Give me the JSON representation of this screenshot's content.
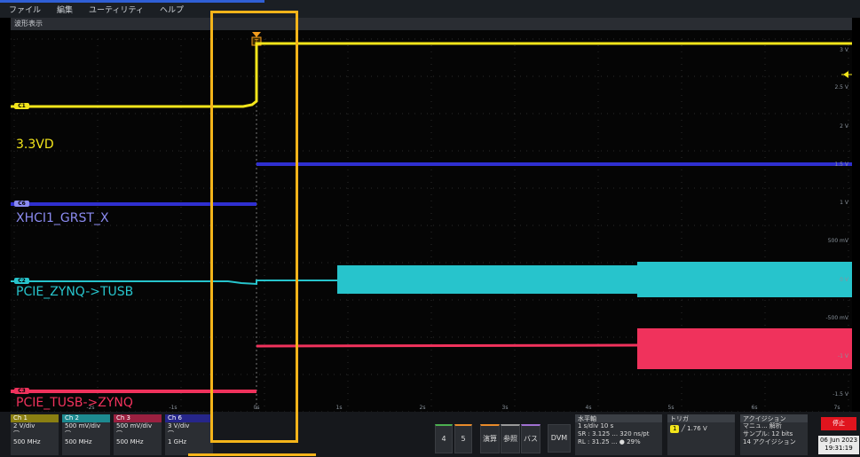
{
  "menu": {
    "items": [
      "ファイル",
      "編集",
      "ユーティリティ",
      "ヘルプ"
    ]
  },
  "window": {
    "title": "波形表示"
  },
  "traces": {
    "c1": {
      "tag": "C1",
      "name": "3.3VD",
      "color": "#f3e51b"
    },
    "c6": {
      "tag": "C6",
      "name": "XHCI1_GRST_X",
      "color": "#2f2fd0"
    },
    "c2": {
      "tag": "C2",
      "name": "PCIE_ZYNQ->TUSB",
      "color": "#27c4cc"
    },
    "c3": {
      "tag": "C3",
      "name": "PCIE_TUSB->ZYNQ",
      "color": "#f0325c"
    }
  },
  "trigger_marker": "T",
  "time_ticks": [
    "-2s",
    "-1s",
    "0s",
    "1s",
    "2s",
    "3s",
    "4s",
    "5s",
    "6s",
    "7s"
  ],
  "volt_ticks": [
    "3 V",
    "2.5 V",
    "2 V",
    "1.5 V",
    "1 V",
    "500 mV",
    "0 V",
    "-500 mV",
    "-1 V",
    "-1.5 V"
  ],
  "channels": [
    {
      "label": "Ch 1",
      "scale": "2 V/div",
      "bw": "500 MHz",
      "color": "#d8c31a"
    },
    {
      "label": "Ch 2",
      "scale": "500 mV/div",
      "bw": "500 MHz",
      "color": "#27c4cc"
    },
    {
      "label": "Ch 3",
      "scale": "500 mV/div",
      "bw": "500 MHz",
      "color": "#e0325c"
    },
    {
      "label": "Ch 6",
      "scale": "3 V/div",
      "bw": "1 GHz",
      "color": "#3b3bd0"
    }
  ],
  "bottom_buttons": [
    "4",
    "5",
    "演算",
    "参照",
    "バス",
    "DVM"
  ],
  "horizontal": {
    "title": "水平軸",
    "rows": [
      "1 s/div        10 s",
      "SR :  3.125 ...   320 ns/pt",
      "RL :  31.25 ...   ● 29%"
    ]
  },
  "trigger": {
    "title": "トリガ",
    "channel": "1",
    "level": "1.76 V"
  },
  "acquisition": {
    "title": "アクイジション",
    "rows": [
      "マニュ...      解析",
      "サンプル: 12 bits",
      "14 アクイジション"
    ]
  },
  "run_state": "停止",
  "date": "06 Jun 2023",
  "time": "19:31:19"
}
